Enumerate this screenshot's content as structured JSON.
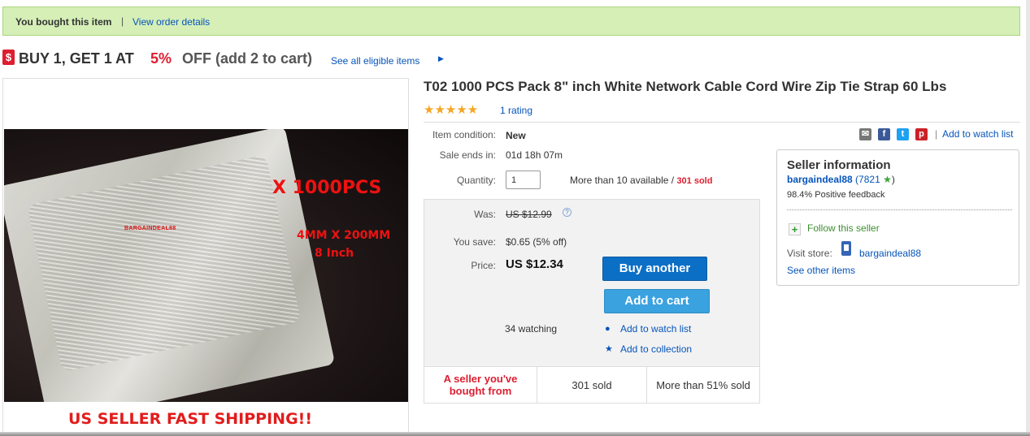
{
  "banner": {
    "bought_text": "You bought this item",
    "separator": "|",
    "view_order_link": "View order details",
    "background_color": "#d5efb7"
  },
  "promo": {
    "tag_icon": "dollar-tag-icon",
    "tag_symbol": "$",
    "text_part1": "BUY 1, GET 1 AT",
    "text_discount": "5%",
    "text_part2": "OFF (add 2 to cart)",
    "see_all_link": "See all eligible items",
    "arrow": "▶",
    "discount_color": "#dd1e31"
  },
  "image": {
    "brand_watermark": "BARGAINDEAL88",
    "qty_overlay": "X 1000PCS",
    "size_overlay": "4MM X 200MM",
    "inch_overlay": "8 Inch",
    "shipping_banner": "US SELLER FAST SHIPPING!!"
  },
  "product": {
    "title": "T02 1000 PCS Pack 8\" inch White Network Cable Cord Wire Zip Tie Strap 60 Lbs",
    "stars": "★★★★★",
    "star_rating": 5,
    "rating_link": "1 rating"
  },
  "details": {
    "condition_label": "Item condition:",
    "condition_value": "New",
    "sale_ends_label": "Sale ends in:",
    "sale_ends_value": "01d 18h 07m",
    "quantity_label": "Quantity:",
    "quantity_value": "1",
    "availability_text": "More than 10 available /",
    "sold_text": "301 sold"
  },
  "share": {
    "email_icon": "email-icon",
    "facebook_icon": "facebook-icon",
    "twitter_icon": "twitter-icon",
    "pinterest_icon": "pinterest-icon",
    "email_glyph": "✉",
    "facebook_glyph": "f",
    "twitter_glyph": "t",
    "pinterest_glyph": "p",
    "separator": "|",
    "watch_link": "Add to watch list"
  },
  "pricing": {
    "was_label": "Was:",
    "was_value": "US $12.99",
    "help_glyph": "?",
    "save_label": "You save:",
    "save_value": "$0.65 (5% off)",
    "price_label": "Price:",
    "price_value": "US $12.34",
    "buy_button": "Buy another",
    "cart_button": "Add to cart",
    "watching": "34 watching",
    "watch_icon": "eye-icon",
    "watch_link": "Add to watch list",
    "collection_icon": "star-icon",
    "collection_link": "Add to collection"
  },
  "stats": {
    "cell1": "A seller you've bought from",
    "cell2": "301 sold",
    "cell3": "More than 51% sold",
    "highlight_color": "#dd1e31"
  },
  "seller": {
    "heading": "Seller information",
    "username": "bargaindeal88",
    "score": "(7821",
    "score_close": ")",
    "star_icon": "green-star-icon",
    "star_glyph": "★",
    "feedback": "98.4% Positive feedback",
    "follow_icon": "plus-icon",
    "follow_glyph": "+",
    "follow_link": "Follow this seller",
    "visit_label": "Visit store:",
    "store_icon": "store-icon",
    "store_name": "bargaindeal88",
    "other_items_link": "See other items"
  }
}
